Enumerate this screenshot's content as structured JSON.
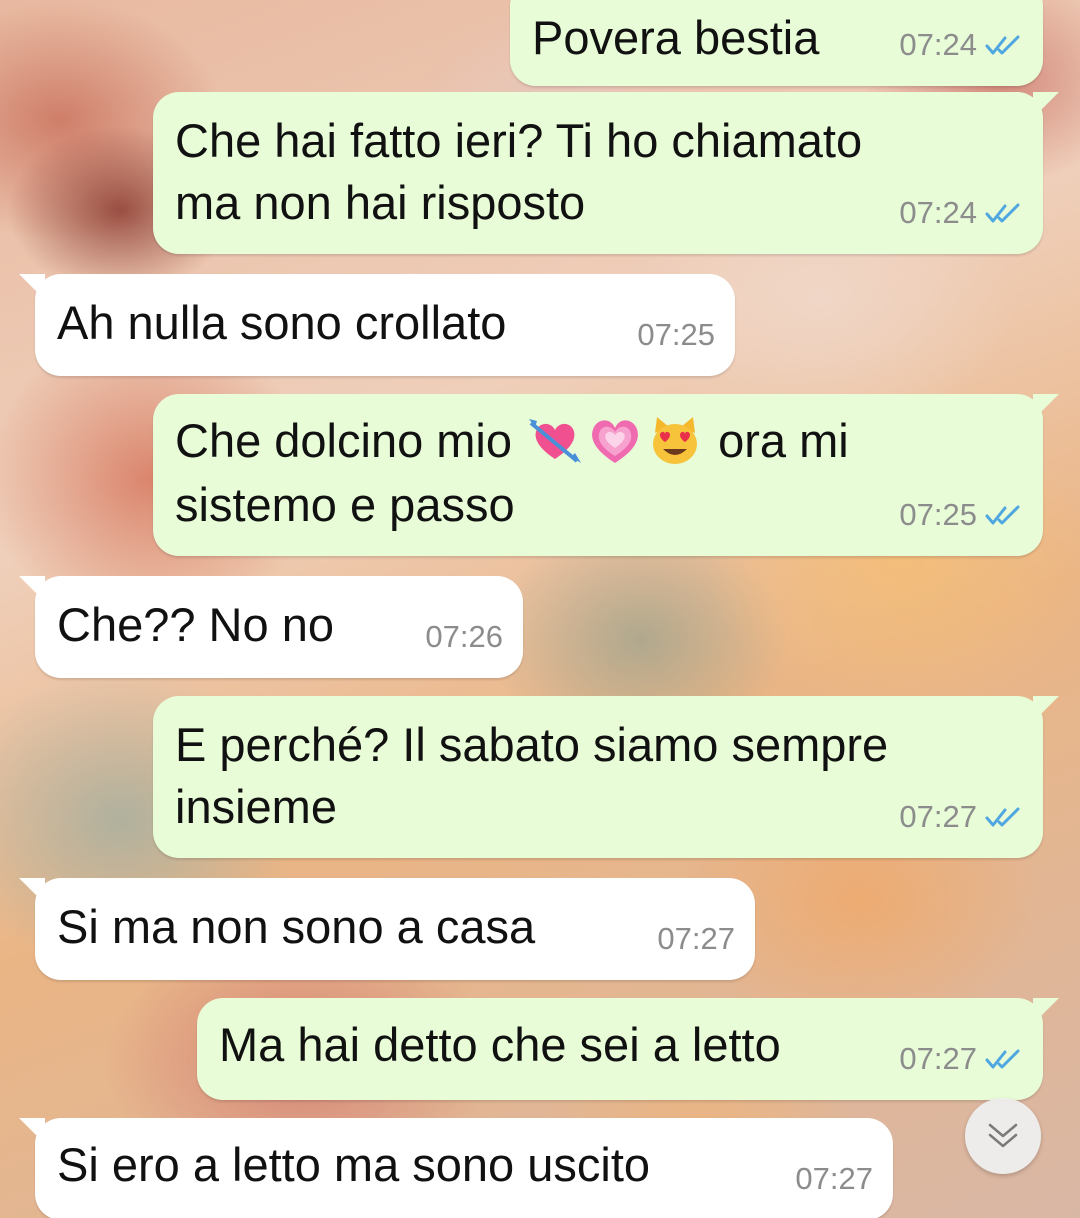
{
  "messages": [
    {
      "direction": "out",
      "text": "Povera bestia",
      "time": "07:24",
      "status": "read"
    },
    {
      "direction": "out",
      "lines": [
        "Che hai fatto ieri? Ti ho chiamato",
        "ma non hai risposto"
      ],
      "time": "07:24",
      "status": "read"
    },
    {
      "direction": "in",
      "text": "Ah nulla sono crollato",
      "time": "07:25"
    },
    {
      "direction": "out",
      "line1_start": "Che dolcino mio ",
      "emojis": [
        "heart-with-arrow",
        "growing-heart",
        "smiling-cat-heart-eyes"
      ],
      "line1_end": " ora mi",
      "line2": "sistemo e passo",
      "time": "07:25",
      "status": "read"
    },
    {
      "direction": "in",
      "text": "Che?? No no",
      "time": "07:26"
    },
    {
      "direction": "out",
      "lines": [
        "E perché? Il sabato siamo sempre",
        "insieme"
      ],
      "time": "07:27",
      "status": "read"
    },
    {
      "direction": "in",
      "text": "Si ma non sono a casa",
      "time": "07:27"
    },
    {
      "direction": "out",
      "text": "Ma hai detto che sei a letto",
      "time": "07:27",
      "status": "read"
    },
    {
      "direction": "in",
      "text": "Si ero a letto ma sono uscito",
      "time": "07:27"
    }
  ],
  "scroll_button": {
    "icon": "double-chevron-down-icon"
  },
  "colors": {
    "outgoing_bubble": "#e7fcd7",
    "incoming_bubble": "#ffffff",
    "read_ticks": "#4fa6e0",
    "timestamp": "#8c8c8c"
  }
}
